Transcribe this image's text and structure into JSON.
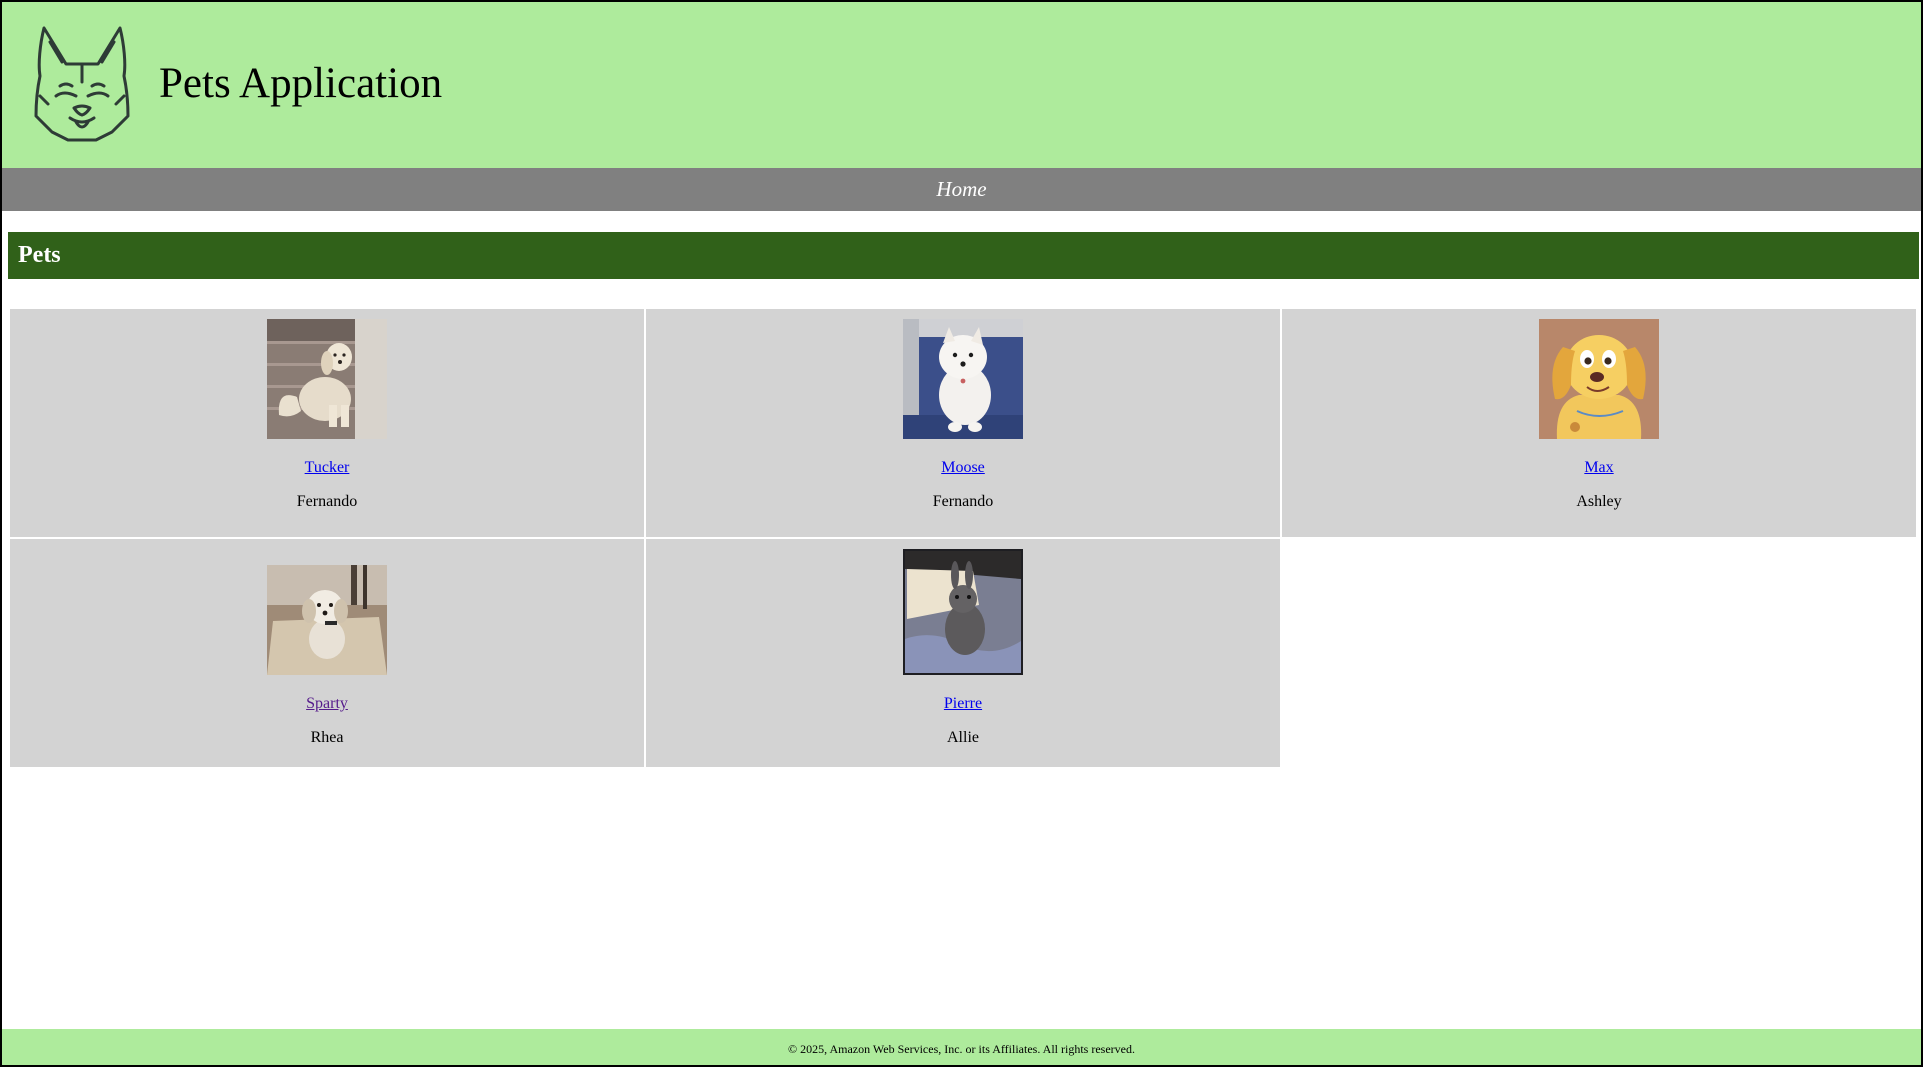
{
  "header": {
    "title": "Pets Application",
    "logo_icon": "dog-head-line-icon"
  },
  "nav": {
    "home_label": "Home"
  },
  "section": {
    "title": "Pets"
  },
  "pets": [
    {
      "name": "Tucker",
      "owner": "Fernando",
      "image": "golden-retriever-on-stairs-photo"
    },
    {
      "name": "Moose",
      "owner": "Fernando",
      "image": "white-fluffy-dog-on-blue-chair-photo"
    },
    {
      "name": "Max",
      "owner": "Ashley",
      "image": "cartoon-golden-retriever-illustration"
    },
    {
      "name": "Sparty",
      "owner": "Rhea",
      "image": "small-shih-tzu-on-rug-photo"
    },
    {
      "name": "Pierre",
      "owner": "Allie",
      "image": "gray-rabbit-in-cage-photo"
    }
  ],
  "footer": {
    "copyright": "© 2025, Amazon Web Services, Inc. or its Affiliates. All rights reserved."
  },
  "colors": {
    "header_bg": "#aeeb9c",
    "nav_bg": "#808080",
    "section_bg": "#306119",
    "card_bg": "#d3d3d3",
    "link": "#0000ee",
    "visited_link": "#551a8b"
  }
}
